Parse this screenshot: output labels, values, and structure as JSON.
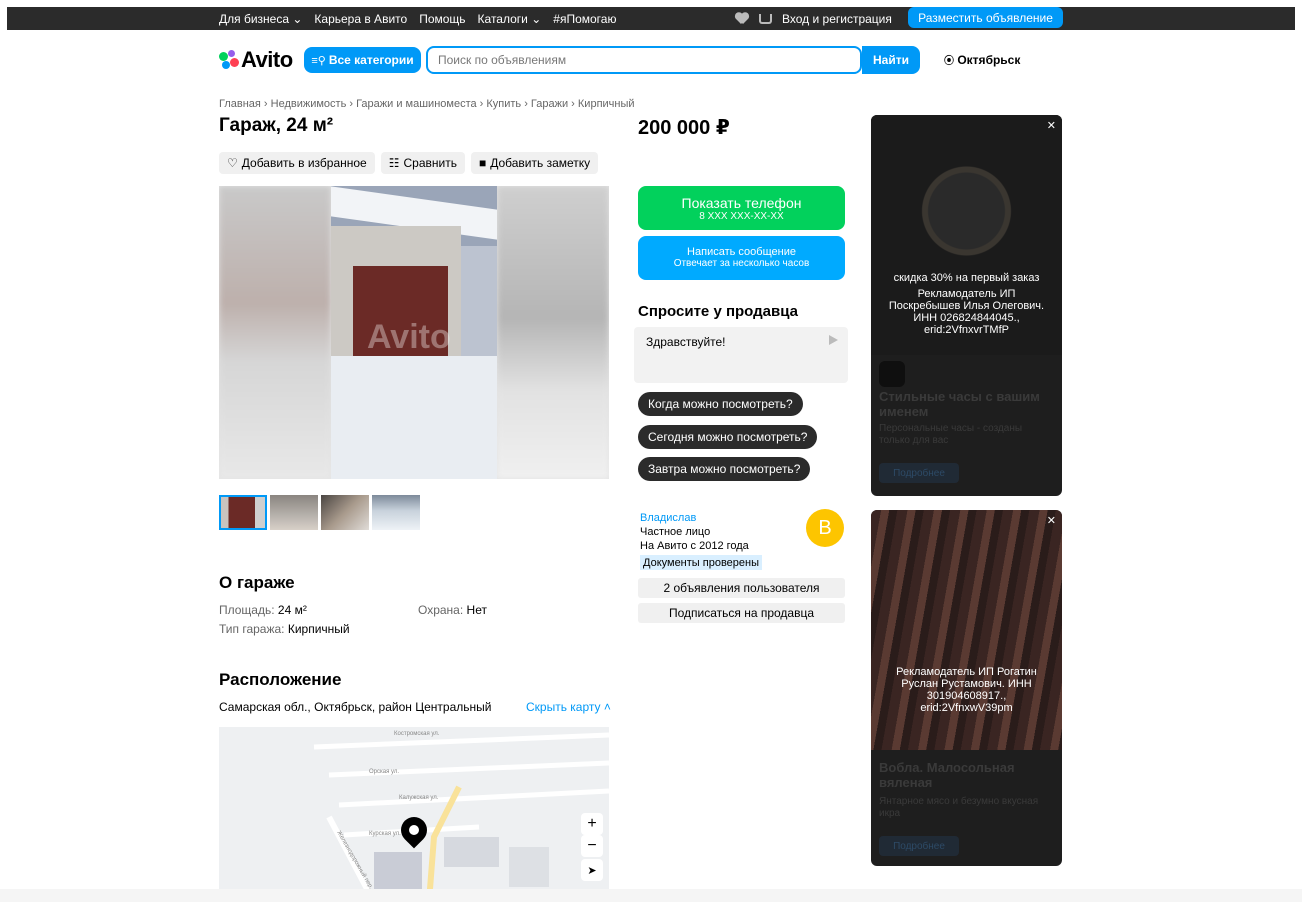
{
  "topbar": {
    "links": [
      "Для бизнеса ⌄",
      "Карьера в Авито",
      "Помощь",
      "Каталоги ⌄",
      "#яПомогаю"
    ],
    "login": "Вход и регистрация",
    "place_ad": "Разместить объявление"
  },
  "header": {
    "logo": "Avito",
    "all_categories": "Все категории",
    "search_placeholder": "Поиск по объявлениям",
    "find": "Найти",
    "city": "Октябрьск"
  },
  "breadcrumbs": "Главная › Недвижимость › Гаражи и машиноместа › Купить › Гаражи › Кирпичный",
  "listing": {
    "title": "Гараж, 24 м²",
    "price": "200 000 ₽",
    "actions": [
      "Добавить в избранное",
      "Сравнить",
      "Добавить заметку"
    ],
    "watermark": "Avito"
  },
  "about": {
    "heading": "О гараже",
    "area_label": "Площадь:",
    "area_value": "24 м²",
    "security_label": "Охрана:",
    "security_value": "Нет",
    "type_label": "Тип гаража:",
    "type_value": "Кирпичный"
  },
  "location": {
    "heading": "Расположение",
    "address": "Самарская обл., Октябрьск, район Центральный",
    "hide_map": "Скрыть карту ˄",
    "streets": [
      "Костромская ул.",
      "Орская ул.",
      "Калужская ул.",
      "Курская ул.",
      "Железнодорожный пер."
    ]
  },
  "contact": {
    "phone_title": "Показать телефон",
    "phone_sub": "8 XXX XXX-XX-XX",
    "msg_title": "Написать сообщение",
    "msg_sub": "Отвечает за несколько часов",
    "ask_heading": "Спросите у продавца",
    "ask_text": "Здравствуйте!",
    "quick": [
      "Когда можно посмотреть?",
      "Сегодня можно посмотреть?",
      "Завтра можно посмотреть?"
    ]
  },
  "seller": {
    "name": "Владислав",
    "type": "Частное лицо",
    "since": "На Авито с 2012 года",
    "verified": "Документы проверены",
    "avatar_letter": "В",
    "listings_btn": "2 объявления пользователя",
    "subscribe_btn": "Подписаться на продавца"
  },
  "ads": [
    {
      "overlay": [
        "скидка 30% на первый заказ",
        "Рекламодатель ИП",
        "Поскребышев Илья Олегович.",
        "ИНН 026824844045.,",
        "erid:2VfnxvrTMfP"
      ],
      "title": "Стильные часы с вашим именем",
      "text": "Персональные часы - созданы только для вас",
      "button": "Подробнее"
    },
    {
      "overlay": [
        "Рекламодатель ИП Рогатин",
        "Руслан Рустамович. ИНН",
        "301904608917.,",
        "erid:2VfnxwV39pm"
      ],
      "title": "Вобла. Малосольная вяленая",
      "text": "Янтарное мясо и безумно вкусная икра",
      "button": "Подробнее"
    }
  ],
  "colors": {
    "accent": "#0099f7",
    "green": "#02d15c",
    "dark": "#2b2b2b",
    "avatar": "#fdc500"
  }
}
